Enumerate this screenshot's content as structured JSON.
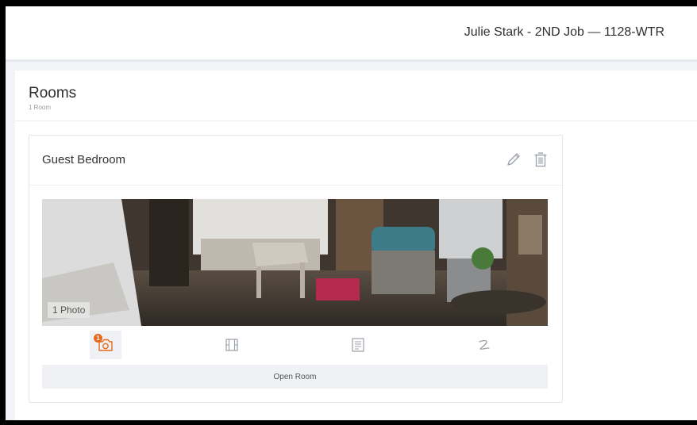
{
  "header": {
    "job_title": "Julie Stark - 2ND Job — 1128-WTR"
  },
  "rooms": {
    "title": "Rooms",
    "count_label": "1 Room",
    "items": [
      {
        "name": "Guest Bedroom",
        "photo_count_label": "1 Photo",
        "photo_badge_count": "1",
        "open_label": "Open Room"
      }
    ]
  },
  "icons": {
    "edit": "pencil-icon",
    "delete": "trash-icon",
    "photos": "camera-icon",
    "videos": "film-icon",
    "notes": "note-icon",
    "sketch": "sketch-icon"
  },
  "colors": {
    "accent": "#e8691b",
    "icon_gray": "#9aa0a8"
  }
}
